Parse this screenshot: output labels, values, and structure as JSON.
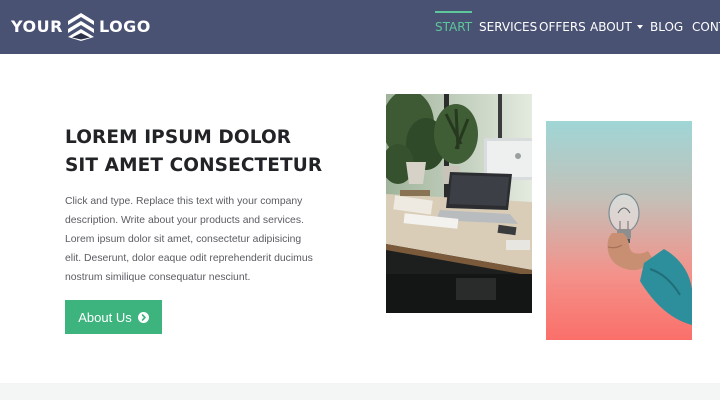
{
  "brand": {
    "word_left": "YOUR",
    "word_right": "LOGO",
    "icon": "chevron-stack-icon"
  },
  "nav": {
    "items": [
      {
        "label": "START",
        "active": true
      },
      {
        "label": "SERVICES",
        "active": false
      },
      {
        "label": "OFFERS",
        "active": false
      },
      {
        "label": "ABOUT",
        "active": false,
        "dropdown": true
      },
      {
        "label": "BLOG",
        "active": false
      },
      {
        "label": "CONT",
        "active": false
      }
    ]
  },
  "hero": {
    "title_line1": "LOREM IPSUM DOLOR",
    "title_line2": "SIT AMET CONSECTETUR",
    "body_lines": [
      "Click and type. Replace this text with your company",
      "description. Write about your products and services.",
      "Lorem ipsum dolor sit amet, consectetur adipisicing",
      "elit. Deserunt, dolor eaque odit reprehenderit ducimus",
      "nostrum similique consequatur nesciunt."
    ],
    "button_label": "About Us",
    "button_icon": "chevron-right-circle-icon"
  },
  "images": [
    {
      "name": "workspace-photo"
    },
    {
      "name": "lightbulb-photo"
    }
  ],
  "colors": {
    "navbar": "#4a5274",
    "accent": "#3db37e",
    "active_nav": "#5cc79a",
    "heading": "#222326",
    "body_text": "#5a5c62"
  }
}
